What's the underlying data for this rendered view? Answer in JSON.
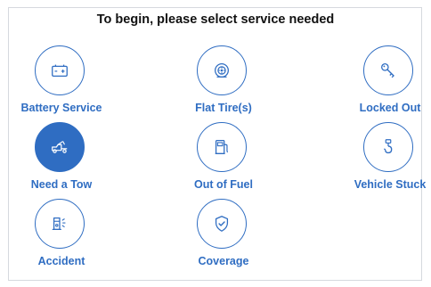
{
  "header": {
    "title": "To begin, please select service needed"
  },
  "services": [
    {
      "label": "Battery Service",
      "icon": "battery-icon",
      "selected": false
    },
    {
      "label": "Flat Tire(s)",
      "icon": "tire-icon",
      "selected": false
    },
    {
      "label": "Locked Out",
      "icon": "key-icon",
      "selected": false
    },
    {
      "label": "Need a Tow",
      "icon": "tow-truck-icon",
      "selected": true
    },
    {
      "label": "Out of Fuel",
      "icon": "fuel-pump-icon",
      "selected": false
    },
    {
      "label": "Vehicle Stuck",
      "icon": "tow-hook-icon",
      "selected": false
    },
    {
      "label": "Accident",
      "icon": "car-crash-icon",
      "selected": false
    },
    {
      "label": "Coverage",
      "icon": "shield-check-icon",
      "selected": false
    }
  ],
  "colors": {
    "accent": "#2f6dc2",
    "title": "#111111",
    "border": "#d6d9de"
  }
}
